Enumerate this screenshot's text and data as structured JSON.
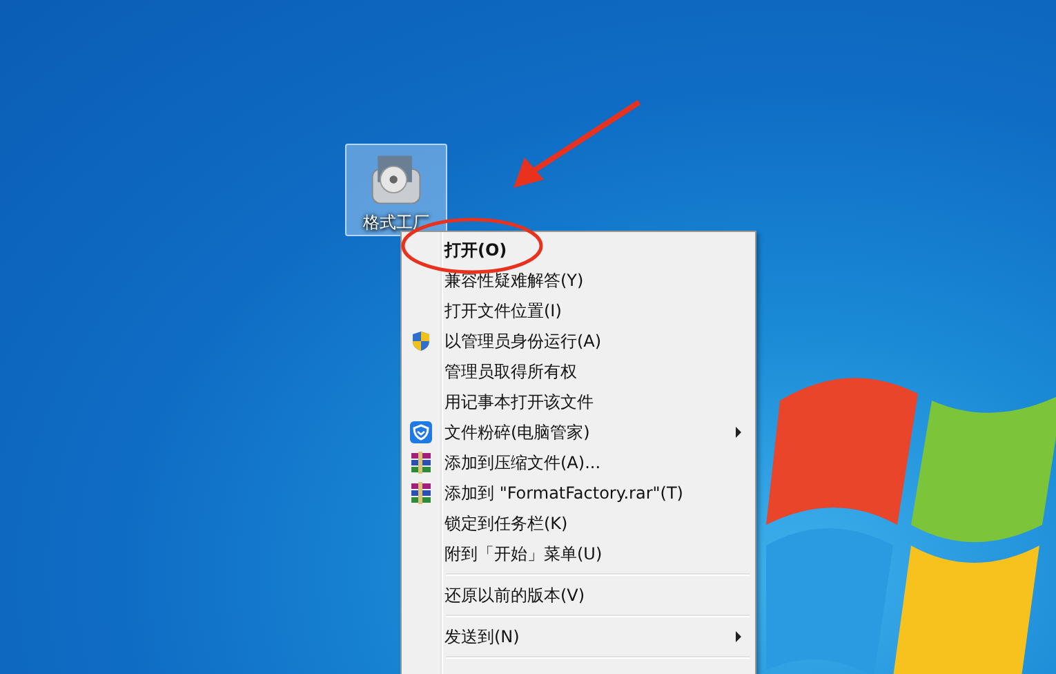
{
  "desktop": {
    "icons": [
      {
        "label": "格式工厂",
        "selected": true
      }
    ]
  },
  "context_menu": {
    "items": [
      {
        "kind": "plain",
        "label": "打开(O)",
        "default": true,
        "submenu": false
      },
      {
        "kind": "plain",
        "label": "兼容性疑难解答(Y)",
        "default": false,
        "submenu": false
      },
      {
        "kind": "plain",
        "label": "打开文件位置(I)",
        "default": false,
        "submenu": false
      },
      {
        "kind": "shield",
        "label": "以管理员身份运行(A)",
        "default": false,
        "submenu": false
      },
      {
        "kind": "plain",
        "label": "管理员取得所有权",
        "default": false,
        "submenu": false
      },
      {
        "kind": "plain",
        "label": "用记事本打开该文件",
        "default": false,
        "submenu": false
      },
      {
        "kind": "guard",
        "label": "文件粉碎(电脑管家)",
        "default": false,
        "submenu": true
      },
      {
        "kind": "archive",
        "label": "添加到压缩文件(A)...",
        "default": false,
        "submenu": false
      },
      {
        "kind": "archive",
        "label": "添加到 \"FormatFactory.rar\"(T)",
        "default": false,
        "submenu": false
      },
      {
        "kind": "plain",
        "label": "锁定到任务栏(K)",
        "default": false,
        "submenu": false
      },
      {
        "kind": "plain",
        "label": "附到「开始」菜单(U)",
        "default": false,
        "submenu": false
      },
      {
        "kind": "separator"
      },
      {
        "kind": "plain",
        "label": "还原以前的版本(V)",
        "default": false,
        "submenu": false
      },
      {
        "kind": "separator"
      },
      {
        "kind": "plain",
        "label": "发送到(N)",
        "default": false,
        "submenu": true
      },
      {
        "kind": "separator"
      }
    ]
  }
}
